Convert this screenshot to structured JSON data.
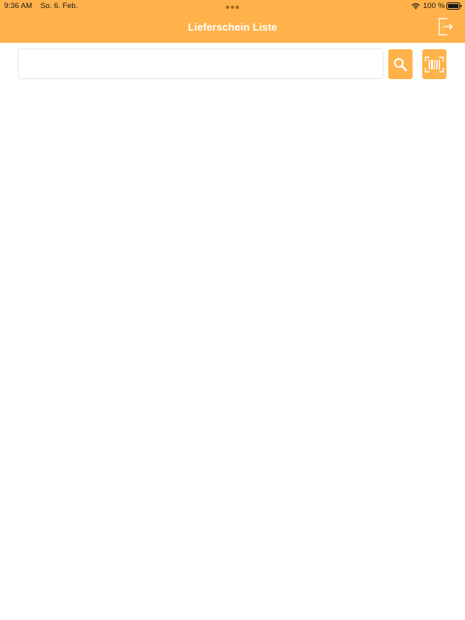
{
  "status_bar": {
    "time": "9:36 AM",
    "date": "So. 6. Feb.",
    "battery_percent": "100 %",
    "wifi_icon": "wifi-icon",
    "battery_icon": "battery-full-icon"
  },
  "navbar": {
    "title": "Lieferschein Liste",
    "logout_icon": "logout-icon"
  },
  "search": {
    "value": "",
    "placeholder": "",
    "search_icon": "search-icon",
    "barcode_icon": "barcode-scan-icon"
  },
  "colors": {
    "accent": "#ffb24a",
    "background": "#ffffff"
  }
}
